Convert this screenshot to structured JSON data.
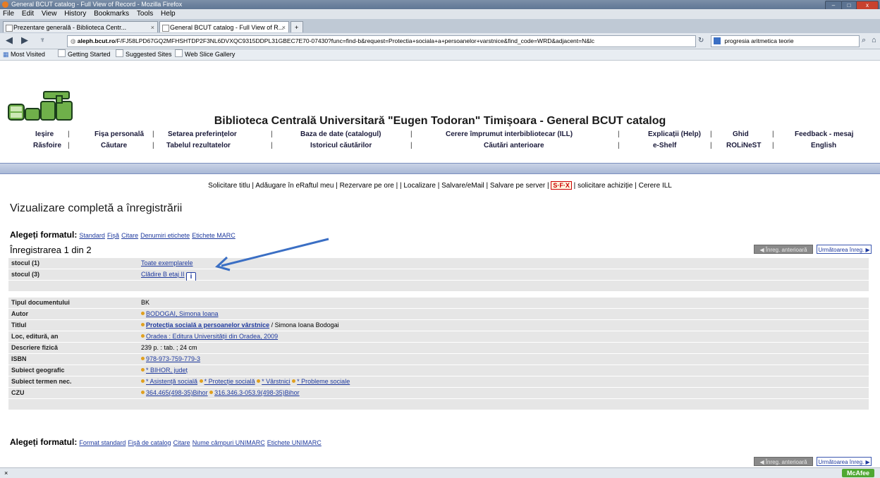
{
  "window": {
    "title": "General BCUT catalog - Full View of Record - Mozilla Firefox",
    "menu": [
      "File",
      "Edit",
      "View",
      "History",
      "Bookmarks",
      "Tools",
      "Help"
    ],
    "tabs": [
      {
        "label": "Prezentare generală - Biblioteca Centr..."
      },
      {
        "label": "General BCUT catalog - Full View of R..."
      }
    ],
    "tab_close": "×",
    "new_tab": "+",
    "url_domain": "aleph.bcut.ro",
    "url_rest": "/F/FJ58LPD67GQ2MFHSHTDP2F3NL6DVXQC9315DDPL31GBEC7E70-07430?func=find-b&request=Protectia+sociala+a+persoanelor+varstnice&find_code=WRD&adjacent=N&lc",
    "search_value": "progresia aritmetica teorie",
    "bookmarks": [
      "Most Visited",
      "Getting Started",
      "Suggested Sites",
      "Web Slice Gallery"
    ],
    "status_text": "×",
    "mcafee": "McAfee"
  },
  "site": {
    "logo_text": "BCUT",
    "title": "Biblioteca Centrală Universitară \"Eugen Todoran\" Timișoara - General BCUT catalog",
    "nav_row1": [
      "Ieșire",
      "Fișa personală",
      "Setarea preferințelor",
      "Baza de date (catalogul)",
      "Cerere împrumut interbibliotecar (ILL)",
      "Explicații (Help)",
      "Ghid",
      "Feedback - mesaj"
    ],
    "nav_row2": [
      "Răsfoire",
      "Căutare",
      "Tabelul rezultatelor",
      "Istoricul căutărilor",
      "Căutări anterioare",
      "e-Shelf",
      "ROLiNeST",
      "English"
    ],
    "actions": {
      "a1": "Solicitare titlu",
      "a2": "Adăugare în eRaftul meu",
      "a3": "Rezervare pe ore",
      "a4": "Localizare",
      "a5": "Salvare/eMail",
      "a6": "Salvare pe server",
      "sfx": "S·F·X",
      "a7": "solicitare achiziție",
      "a8": "Cerere ILL"
    },
    "heading": "Vizualizare completă a înregistrării",
    "format1": {
      "label": "Alegeți formatul:",
      "links": [
        "Standard",
        "Fișă",
        "Citare",
        "Denumiri etichete",
        "Etichete MARC"
      ]
    },
    "record_number": "Înregistrarea 1 din 2",
    "prev_label": "◀ Înreg. anterioară",
    "next_label": "Următoarea înreg. ▶",
    "holdings": [
      {
        "label": "stocul (1)",
        "value": "Toate exemplarele"
      },
      {
        "label": "stocul (3)",
        "value": "Clădire B etaj II",
        "icon": "i"
      }
    ],
    "fields": {
      "tip_label": "Tipul documentului",
      "tip": "BK",
      "autor_label": "Autor",
      "autor": "BODOGAI, Simona Ioana",
      "titlu_label": "Titlul",
      "titlu_link": "Protecția socială a persoanelor vârstnice",
      "titlu_rest": " / Simona Ioana Bodogai",
      "loc_label": "Loc, editură, an",
      "loc": "Oradea : Editura Universității din Oradea, 2009",
      "descriere_label": "Descriere fizică",
      "descriere": "239 p. : tab. ; 24 cm",
      "isbn_label": "ISBN",
      "isbn": "978-973-759-779-3",
      "geo_label": "Subiect geografic",
      "geo": "* BIHOR, județ",
      "subiect_label": "Subiect termen nec.",
      "subiecte": [
        "* Asistență socială",
        "* Protecție socială",
        "* Vârstnici",
        "* Probleme sociale"
      ],
      "czu_label": "CZU",
      "czu": [
        "364.465(498-35)Bihor",
        "316.346.3-053.9(498-35)Bihor"
      ]
    },
    "format2": {
      "label": "Alegeți formatul:",
      "links": [
        "Format standard",
        "Fișă de catalog",
        "Citare",
        "Nume câmpuri UNIMARC",
        "Etichete UNIMARC"
      ]
    }
  },
  "colors": {
    "link": "#1f3a9e",
    "row_bg": "#e6e6e6",
    "bar": "#a9b8d6",
    "arrow": "#3b6fc4"
  }
}
